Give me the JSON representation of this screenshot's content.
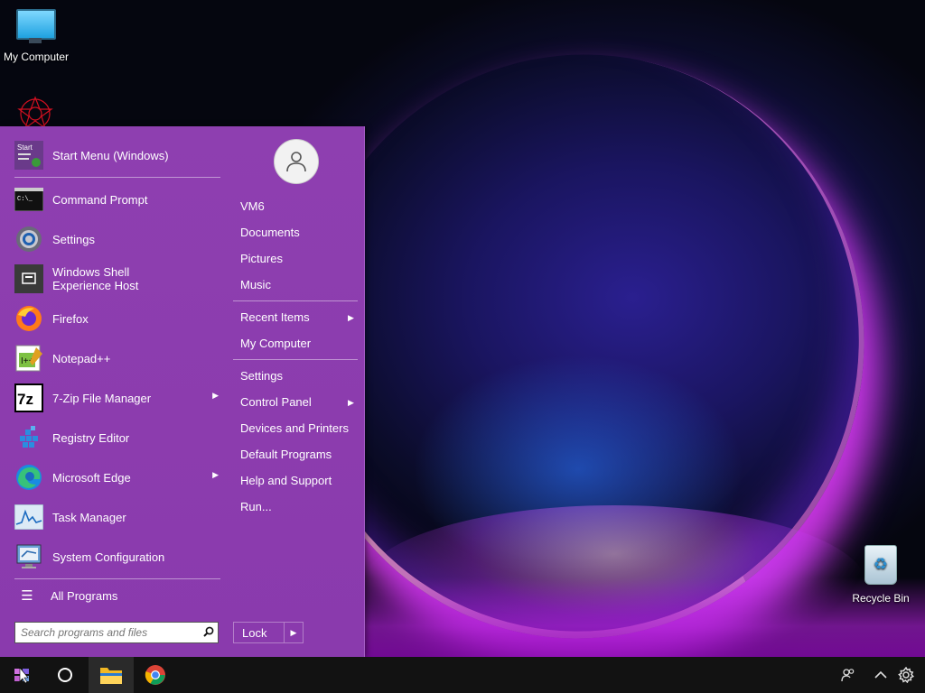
{
  "desktop": {
    "icons": [
      {
        "label": "My Computer"
      },
      {
        "label": "Recycle Bin"
      }
    ]
  },
  "start_menu": {
    "programs": [
      {
        "label": "Start Menu (Windows)",
        "icon": "start-menu-icon",
        "submenu": false
      },
      {
        "label": "Command Prompt",
        "icon": "command-prompt-icon",
        "submenu": false
      },
      {
        "label": "Settings",
        "icon": "settings-gear-icon",
        "submenu": false
      },
      {
        "label": "Windows Shell Experience Host",
        "icon": "shell-host-icon",
        "submenu": false
      },
      {
        "label": "Firefox",
        "icon": "firefox-icon",
        "submenu": false
      },
      {
        "label": "Notepad++",
        "icon": "notepad-plus-plus-icon",
        "submenu": false
      },
      {
        "label": "7-Zip File Manager",
        "icon": "7zip-icon",
        "submenu": true
      },
      {
        "label": "Registry Editor",
        "icon": "registry-editor-icon",
        "submenu": false
      },
      {
        "label": "Microsoft Edge",
        "icon": "edge-icon",
        "submenu": true
      },
      {
        "label": "Task Manager",
        "icon": "task-manager-icon",
        "submenu": false
      },
      {
        "label": "System Configuration",
        "icon": "system-configuration-icon",
        "submenu": false
      }
    ],
    "all_programs": "All Programs",
    "search_placeholder": "Search programs and files",
    "right_items": {
      "user": "VM6",
      "documents": "Documents",
      "pictures": "Pictures",
      "music": "Music",
      "recent_items": "Recent Items",
      "my_computer": "My Computer",
      "settings": "Settings",
      "control_panel": "Control Panel",
      "devices_printers": "Devices and Printers",
      "default_programs": "Default Programs",
      "help_support": "Help and Support",
      "run": "Run..."
    },
    "lock_label": "Lock"
  },
  "taskbar": {
    "items": [
      "start-button",
      "search-circle",
      "file-explorer",
      "chrome"
    ],
    "tray": [
      "people-icon",
      "show-hidden-icons",
      "settings-icon"
    ]
  },
  "colors": {
    "menu_bg": "#8e3fb0",
    "taskbar_bg": "#121212"
  }
}
